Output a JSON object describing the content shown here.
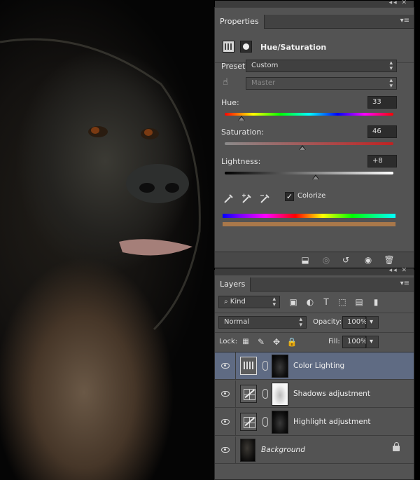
{
  "photo": {
    "subject": "gorilla portrait"
  },
  "properties": {
    "tab_label": "Properties",
    "adjustment_title": "Hue/Saturation",
    "preset_label": "Preset:",
    "preset_value": "Custom",
    "channel_value": "Master",
    "hue_label": "Hue:",
    "hue_value": "33",
    "hue_fraction": 0.1,
    "saturation_label": "Saturation:",
    "saturation_value": "46",
    "saturation_fraction": 0.46,
    "lightness_label": "Lightness:",
    "lightness_value": "+8",
    "lightness_fraction": 0.54,
    "colorize_label": "Colorize",
    "colorize_checked": true,
    "result_bar_color": "#a9784a"
  },
  "layers": {
    "tab_label": "Layers",
    "filter_kind": "Kind",
    "blend_mode": "Normal",
    "opacity_label": "Opacity:",
    "opacity_value": "100%",
    "lock_label": "Lock:",
    "fill_label": "Fill:",
    "fill_value": "100%",
    "rows": [
      {
        "name": "Color Lighting",
        "type": "hue-saturation",
        "selected": true
      },
      {
        "name": "Shadows adjustment",
        "type": "curves"
      },
      {
        "name": "Highlight adjustment",
        "type": "curves"
      },
      {
        "name": "Background",
        "type": "image",
        "locked": true
      }
    ]
  },
  "colors": {
    "panel_bg": "#535353",
    "selected_row": "#5f6b83",
    "accent": "#a9784a"
  }
}
